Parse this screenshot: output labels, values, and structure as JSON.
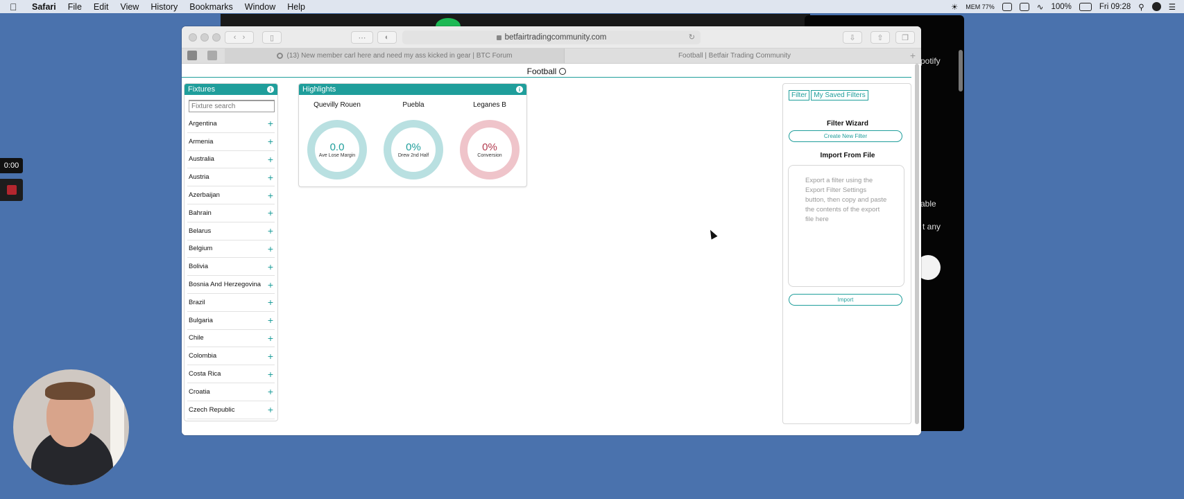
{
  "menubar": {
    "app": "Safari",
    "items": [
      "File",
      "Edit",
      "View",
      "History",
      "Bookmarks",
      "Window",
      "Help"
    ],
    "status_mem": "MEM 77%",
    "battery": "100%",
    "clock": "Fri 09:28"
  },
  "background": {
    "text1": "potify",
    "text2": "able",
    "text3": "t any"
  },
  "recording": {
    "time": "0:00"
  },
  "browser": {
    "url": "betfairtradingcommunity.com",
    "tabs": [
      {
        "label": "(13) New member carl here and need my ass kicked in gear | BTC Forum"
      },
      {
        "label": "Football | Betfair Trading Community"
      }
    ]
  },
  "page": {
    "title": "Football",
    "fixtures": {
      "heading": "Fixtures",
      "search_placeholder": "Fixture search",
      "countries": [
        "Argentina",
        "Armenia",
        "Australia",
        "Austria",
        "Azerbaijan",
        "Bahrain",
        "Belarus",
        "Belgium",
        "Bolivia",
        "Bosnia And Herzegovina",
        "Brazil",
        "Bulgaria",
        "Chile",
        "Colombia",
        "Costa Rica",
        "Croatia",
        "Czech Republic"
      ]
    },
    "highlights": {
      "heading": "Highlights",
      "items": [
        {
          "team": "Quevilly Rouen",
          "value": "0.0",
          "label": "Ave Lose Margin",
          "color": "#b9e0e1",
          "text_color": "#1f9e9b"
        },
        {
          "team": "Puebla",
          "value": "0%",
          "label": "Drew 2nd Half",
          "color": "#b9e0e1",
          "text_color": "#1f9e9b"
        },
        {
          "team": "Leganes B",
          "value": "0%",
          "label": "Conversion",
          "color": "#efc4ca",
          "text_color": "#b23a4e"
        }
      ]
    },
    "filter_panel": {
      "tab_filter": "Filter",
      "tab_saved": "My Saved Filters",
      "wizard_title": "Filter Wizard",
      "create_button": "Create New Filter",
      "import_title": "Import From File",
      "import_placeholder": "Export a filter using the Export Filter Settings button, then copy and paste the contents of the export file here",
      "import_button": "Import"
    }
  },
  "colors": {
    "accent": "#1f9e9b",
    "desktop": "#4a72ad"
  }
}
